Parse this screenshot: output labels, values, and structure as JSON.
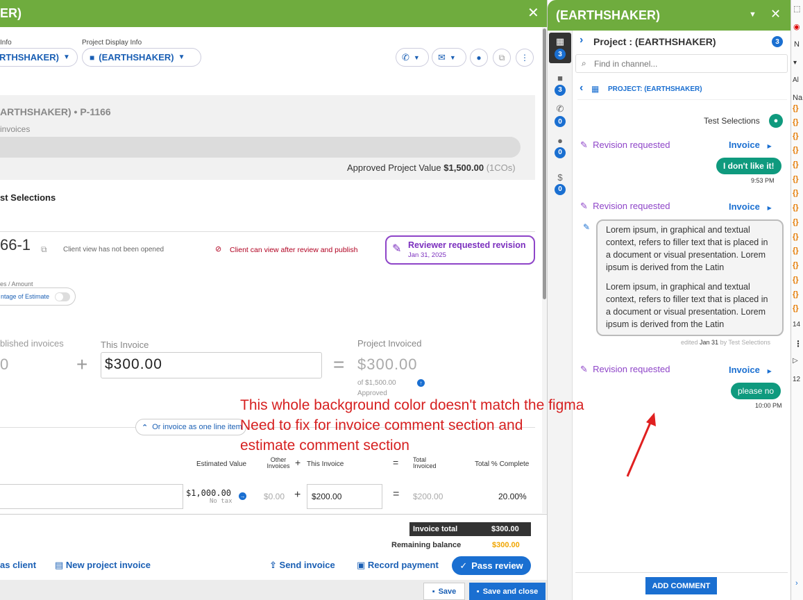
{
  "left": {
    "header_title": "ER)",
    "label_info": "Info",
    "label_project_display_info": "Project Display Info",
    "dropdown_1": "RTHSHAKER)",
    "dropdown_2": "(EARTHSHAKER)",
    "project_heading": "ARTHSHAKER) • P-1166",
    "invoices_label": "invoices",
    "approved_project_value_label": "Approved Project Value",
    "approved_project_value": "$1,500.00",
    "approved_cos": "(1COs)",
    "test_selections": "st Selections",
    "invoice_number": "66-1",
    "client_view_status": "Client view has not been opened",
    "client_can_view": "Client can view after review and publish",
    "reviewer_status": "Reviewer requested revision",
    "reviewer_date": "Jan 31, 2025",
    "amount_type_label": "es / Amount",
    "percentage_toggle": "ntage of Estimate",
    "published_invoices_label": "blished invoices",
    "published_invoices_value": "0",
    "this_invoice_label": "This Invoice",
    "this_invoice_value": "$300.00",
    "project_invoiced_label": "Project Invoiced",
    "project_invoiced_value": "$300.00",
    "of_amount": "of $1,500.00",
    "approved": "Approved",
    "one_line_item": "Or invoice as one line item",
    "col_estimated_value": "Estimated Value",
    "col_other_invoices": "Other Invoices",
    "col_this_invoice": "This Invoice",
    "col_total_invoiced": "Total Invoiced",
    "col_total_complete": "Total % Complete",
    "row_estimated": "$1,000.00",
    "row_no_tax": "No tax",
    "row_other": "$0.00",
    "row_this": "$200.00",
    "row_total": "$200.00",
    "row_percent": "20.00%",
    "invoice_total_label": "Invoice total",
    "invoice_total": "$300.00",
    "remaining_balance_label": "Remaining balance",
    "remaining_balance": "$300.00",
    "as_client": "as client",
    "new_project_invoice": "New project invoice",
    "send_invoice": "Send invoice",
    "record_payment": "Record payment",
    "pass_review": "Pass review",
    "save": "Save",
    "save_and_close": "Save and close"
  },
  "annotation": {
    "line1": "This whole background color doesn't match the figma",
    "line2": "Need to fix for invoice comment section and",
    "line3": "estimate comment section"
  },
  "right": {
    "header_title": "(EARTHSHAKER)",
    "project_title": "Project : (EARTHSHAKER)",
    "project_count": "3",
    "search_placeholder": "Find in channel...",
    "channel_name": "PROJECT: (EARTHSHAKER)",
    "rail": [
      {
        "icon": "chat-stack-icon",
        "count": "3"
      },
      {
        "icon": "folder-icon",
        "count": "3"
      },
      {
        "icon": "phone-icon",
        "count": "0"
      },
      {
        "icon": "comments-icon",
        "count": "0"
      },
      {
        "icon": "money-hand-icon",
        "count": "0"
      }
    ],
    "author": "Test Selections",
    "revision_requested": "Revision requested",
    "invoice_link": "Invoice",
    "msg1": "I don't like it!",
    "msg1_time": "9:53 PM",
    "long_para1": "Lorem ipsum, in graphical and textual context, refers to filler text that is placed in a document or visual presentation. Lorem ipsum is derived from the Latin",
    "long_para2": "Lorem ipsum, in graphical and textual context, refers to filler text that is placed in a document or visual presentation. Lorem ipsum is derived from the Latin",
    "edited_prefix": "edited",
    "edited_date": "Jan 31",
    "edited_by": "by Test Selections",
    "msg3": "please no",
    "msg3_time": "10:00 PM",
    "add_comment": "ADD COMMENT"
  },
  "far_right": {
    "n1": "N",
    "al": "Al",
    "na": "Na",
    "r14": "14",
    "r12": "12"
  }
}
